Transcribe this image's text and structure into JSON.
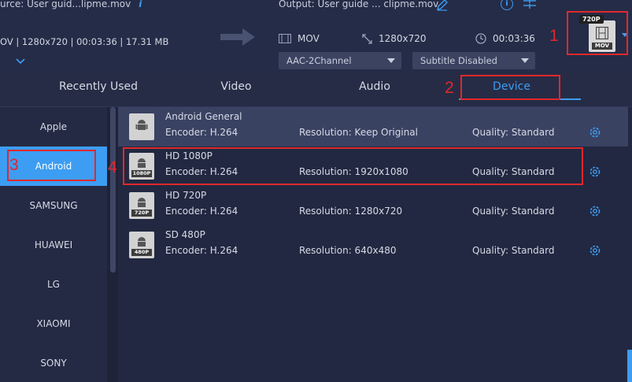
{
  "source": {
    "label": "urce: User guid...lipme.mov",
    "info": "OV | 1280x720 | 00:03:36 | 17.31 MB"
  },
  "output": {
    "label": "Output: User guide ... clipme.mov",
    "format": "MOV",
    "resolution": "1280x720",
    "duration": "00:03:36",
    "audio": "AAC-2Channel",
    "subtitle": "Subtitle Disabled"
  },
  "format_icon": {
    "badge": "720P",
    "label": "MOV"
  },
  "annotations": {
    "n1": "1",
    "n2": "2",
    "n3": "3",
    "n4": "4"
  },
  "tabs": [
    {
      "label": "Recently Used"
    },
    {
      "label": "Video"
    },
    {
      "label": "Audio"
    },
    {
      "label": "Device"
    }
  ],
  "sidebar": {
    "items": [
      {
        "label": "Apple"
      },
      {
        "label": "Android"
      },
      {
        "label": "SAMSUNG"
      },
      {
        "label": "HUAWEI"
      },
      {
        "label": "LG"
      },
      {
        "label": "XIAOMI"
      },
      {
        "label": "SONY"
      }
    ]
  },
  "presets": [
    {
      "title": "Android General",
      "encoder": "Encoder: H.264",
      "resolution": "Resolution: Keep Original",
      "quality": "Quality: Standard",
      "tag": ""
    },
    {
      "title": "HD 1080P",
      "encoder": "Encoder: H.264",
      "resolution": "Resolution: 1920x1080",
      "quality": "Quality: Standard",
      "tag": "1080P"
    },
    {
      "title": "HD 720P",
      "encoder": "Encoder: H.264",
      "resolution": "Resolution: 1280x720",
      "quality": "Quality: Standard",
      "tag": "720P"
    },
    {
      "title": "SD 480P",
      "encoder": "Encoder: H.264",
      "resolution": "Resolution: 640x480",
      "quality": "Quality: Standard",
      "tag": "480P"
    }
  ],
  "colors": {
    "accent": "#3d9df2",
    "highlight_red": "#e0282c",
    "background": "#1e2337"
  }
}
